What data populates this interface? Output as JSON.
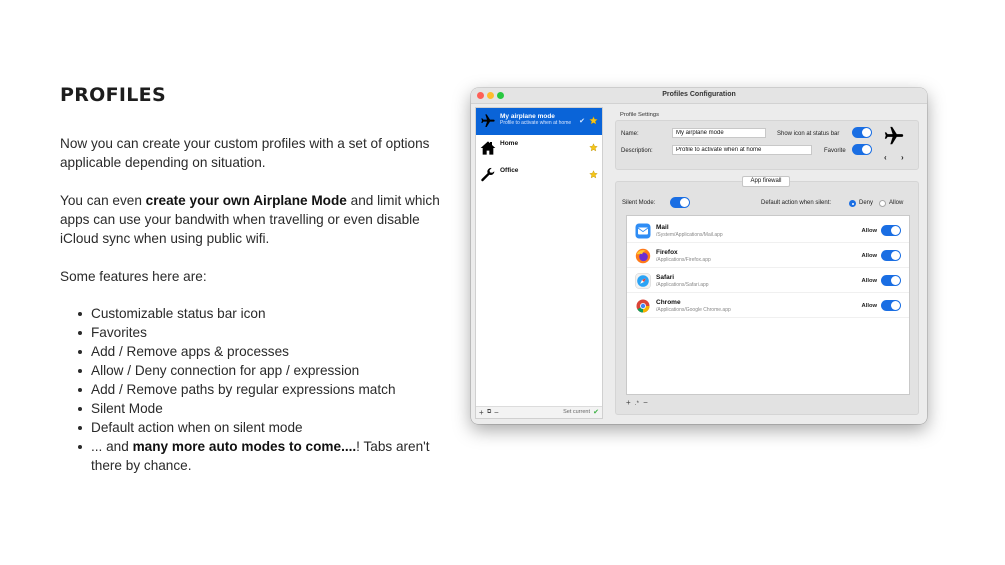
{
  "slide": {
    "title": "PROFILES",
    "p1": "Now you can create your custom profiles with a set of options applicable depending on situation.",
    "p2_prefix": "You can even ",
    "p2_bold": "create your own Airplane Mode",
    "p2_suffix": " and limit which apps can use your bandwith when travelling or even disable iCloud sync when using public wifi.",
    "p3": "Some features here are:",
    "features": [
      "Customizable status bar icon",
      "Favorites",
      "Add / Remove apps & processes",
      "Allow / Deny connection for app / expression",
      "Add / Remove paths by regular expressions match",
      "Silent Mode",
      "Default action when on silent mode"
    ],
    "last_feature_prefix": "... and ",
    "last_feature_bold": "many more auto modes to come....",
    "last_feature_suffix": "! Tabs aren't there by chance."
  },
  "window": {
    "title": "Profiles Configuration",
    "sidebar": {
      "profiles": [
        {
          "name": "My airplane mode",
          "description": "Profile to activate when at home",
          "icon": "airplane-icon",
          "selected": true,
          "current": true,
          "favorite": true
        },
        {
          "name": "Home",
          "description": "",
          "icon": "house-icon",
          "selected": false,
          "favorite": true
        },
        {
          "name": "Office",
          "description": "",
          "icon": "wrench-icon",
          "selected": false,
          "favorite": true
        }
      ],
      "footer_add": "+",
      "footer_duplicate": "⧉",
      "footer_remove": "−",
      "set_current": "Set current",
      "set_current_check": "✔"
    },
    "settings": {
      "section_label": "Profile Settings",
      "name_label": "Name:",
      "name_value": "My airplane mode",
      "description_label": "Description:",
      "description_value": "Profile to activate when at home",
      "show_icon_label": "Show icon at status bar",
      "show_icon_on": true,
      "favorite_label": "Favorite",
      "favorite_on": true,
      "prev_arrow": "‹",
      "next_arrow": "›"
    },
    "firewall": {
      "tab_label": "App firewall",
      "silent_mode_label": "Silent Mode:",
      "silent_mode_on": true,
      "default_action_label": "Default action when silent:",
      "deny_label": "Deny",
      "allow_label": "Allow",
      "selected_action": "Deny",
      "apps": [
        {
          "name": "Mail",
          "path": "/System/Applications/Mail.app",
          "action": "Allow",
          "on": true,
          "icon": "mail-icon"
        },
        {
          "name": "Firefox",
          "path": "/Applications/Firefox.app",
          "action": "Allow",
          "on": true,
          "icon": "firefox-icon"
        },
        {
          "name": "Safari",
          "path": "/Applications/Safari.app",
          "action": "Allow",
          "on": true,
          "icon": "safari-icon"
        },
        {
          "name": "Chrome",
          "path": "/Applications/Google Chrome.app",
          "action": "Allow",
          "on": true,
          "icon": "chrome-icon"
        }
      ],
      "footer_add": "+",
      "footer_regex": ".*",
      "footer_remove": "−"
    },
    "colors": {
      "accent": "#1a6ee3",
      "selection": "#0a64d8",
      "star": "#f5c518"
    }
  }
}
